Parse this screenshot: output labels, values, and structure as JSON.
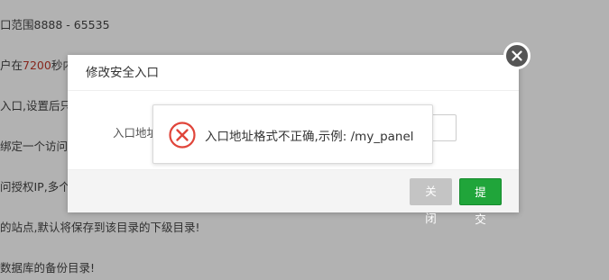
{
  "background": {
    "lines": [
      {
        "text": "口范围8888 - 65535"
      },
      {
        "pre": "户在",
        "highlight": "7200",
        "post": "秒内"
      },
      {
        "text": "入口,设置后只"
      },
      {
        "text": "绑定一个访问域"
      },
      {
        "text": "问授权IP,多个请"
      },
      {
        "text": "的站点,默认将保存到该目录的下级目录!"
      },
      {
        "text": "数据库的备份目录!"
      }
    ],
    "highlight_color": "#c0392b"
  },
  "modal": {
    "title": "修改安全入口",
    "field_label": "入口地址",
    "field_value": "",
    "close_label": "关闭",
    "submit_label": "提交"
  },
  "toast": {
    "icon": "error-circle-icon",
    "message": "入口地址格式不正确,示例: /my_panel",
    "icon_color": "#e0453a"
  }
}
